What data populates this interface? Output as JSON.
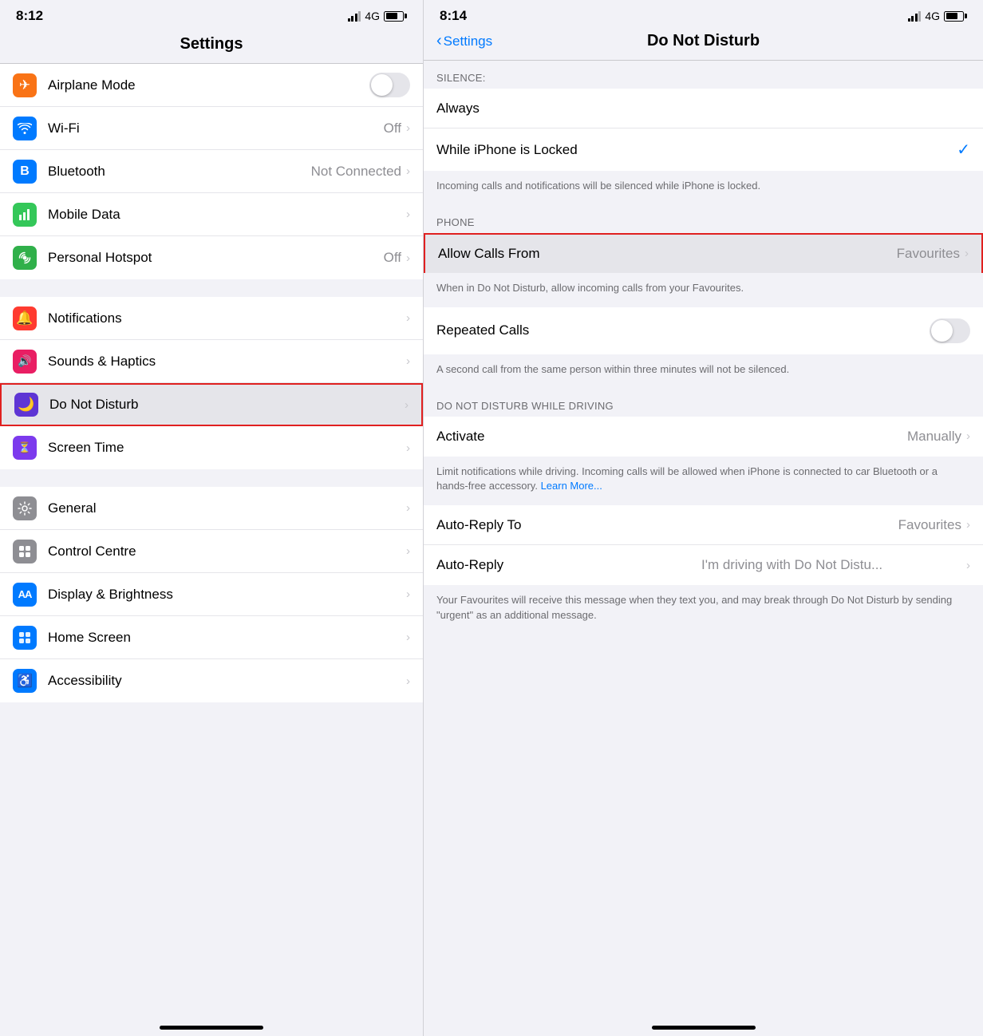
{
  "left": {
    "status": {
      "time": "8:12",
      "network": "4G"
    },
    "title": "Settings",
    "sections": [
      {
        "items": [
          {
            "id": "airplane-mode",
            "icon": "✈",
            "iconClass": "icon-orange",
            "label": "Airplane Mode",
            "value": "",
            "hasToggle": true,
            "toggleOn": false,
            "hasChevron": false
          },
          {
            "id": "wifi",
            "icon": "wifi",
            "iconClass": "icon-blue",
            "label": "Wi-Fi",
            "value": "Off",
            "hasToggle": false,
            "hasChevron": true
          },
          {
            "id": "bluetooth",
            "icon": "bt",
            "iconClass": "icon-blue-dark",
            "label": "Bluetooth",
            "value": "Not Connected",
            "hasToggle": false,
            "hasChevron": true
          },
          {
            "id": "mobile-data",
            "icon": "📶",
            "iconClass": "icon-green",
            "label": "Mobile Data",
            "value": "",
            "hasToggle": false,
            "hasChevron": true
          },
          {
            "id": "personal-hotspot",
            "icon": "∞",
            "iconClass": "icon-green2",
            "label": "Personal Hotspot",
            "value": "Off",
            "hasToggle": false,
            "hasChevron": true
          }
        ]
      },
      {
        "items": [
          {
            "id": "notifications",
            "icon": "🔔",
            "iconClass": "icon-red",
            "label": "Notifications",
            "value": "",
            "hasToggle": false,
            "hasChevron": true
          },
          {
            "id": "sounds-haptics",
            "icon": "🔊",
            "iconClass": "icon-pink",
            "label": "Sounds & Haptics",
            "value": "",
            "hasToggle": false,
            "hasChevron": true
          },
          {
            "id": "do-not-disturb",
            "icon": "🌙",
            "iconClass": "icon-purple",
            "label": "Do Not Disturb",
            "value": "",
            "hasToggle": false,
            "hasChevron": true,
            "highlighted": true
          },
          {
            "id": "screen-time",
            "icon": "⏳",
            "iconClass": "icon-purple2",
            "label": "Screen Time",
            "value": "",
            "hasToggle": false,
            "hasChevron": true
          }
        ]
      },
      {
        "items": [
          {
            "id": "general",
            "icon": "⚙",
            "iconClass": "icon-gray",
            "label": "General",
            "value": "",
            "hasToggle": false,
            "hasChevron": true
          },
          {
            "id": "control-centre",
            "icon": "⊞",
            "iconClass": "icon-gray",
            "label": "Control Centre",
            "value": "",
            "hasToggle": false,
            "hasChevron": true
          },
          {
            "id": "display-brightness",
            "icon": "AA",
            "iconClass": "icon-blue",
            "label": "Display & Brightness",
            "value": "",
            "hasToggle": false,
            "hasChevron": true
          },
          {
            "id": "home-screen",
            "icon": "⬡",
            "iconClass": "icon-blue",
            "label": "Home Screen",
            "value": "",
            "hasToggle": false,
            "hasChevron": true
          },
          {
            "id": "accessibility",
            "icon": "♿",
            "iconClass": "icon-blue",
            "label": "Accessibility",
            "value": "",
            "hasToggle": false,
            "hasChevron": true
          }
        ]
      }
    ]
  },
  "right": {
    "status": {
      "time": "8:14",
      "network": "4G"
    },
    "back_label": "Settings",
    "title": "Do Not Disturb",
    "silence_section_label": "SILENCE:",
    "silence_items": [
      {
        "id": "always",
        "label": "Always",
        "hasCheckmark": false
      },
      {
        "id": "while-locked",
        "label": "While iPhone is Locked",
        "hasCheckmark": true
      }
    ],
    "silence_info": "Incoming calls and notifications will be silenced while iPhone is locked.",
    "phone_section_label": "PHONE",
    "phone_items": [
      {
        "id": "allow-calls-from",
        "label": "Allow Calls From",
        "value": "Favourites",
        "highlighted": true,
        "hasChevron": true
      }
    ],
    "phone_info": "When in Do Not Disturb, allow incoming calls from your Favourites.",
    "repeated_calls_label": "Repeated Calls",
    "repeated_calls_toggle": false,
    "repeated_calls_info": "A second call from the same person within three minutes will not be silenced.",
    "driving_section_label": "DO NOT DISTURB WHILE DRIVING",
    "driving_items": [
      {
        "id": "activate",
        "label": "Activate",
        "value": "Manually",
        "hasChevron": true
      }
    ],
    "driving_info": "Limit notifications while driving. Incoming calls will be allowed when iPhone is connected to car Bluetooth or a hands-free accessory.",
    "driving_learn_more": "Learn More...",
    "autoreply_items": [
      {
        "id": "auto-reply-to",
        "label": "Auto-Reply To",
        "value": "Favourites",
        "hasChevron": true
      },
      {
        "id": "auto-reply",
        "label": "Auto-Reply",
        "value": "I'm driving with Do Not Distu...",
        "hasChevron": true
      }
    ],
    "autoreply_info": "Your Favourites will receive this message when they text you, and may break through Do Not Disturb by sending \"urgent\" as an additional message."
  }
}
